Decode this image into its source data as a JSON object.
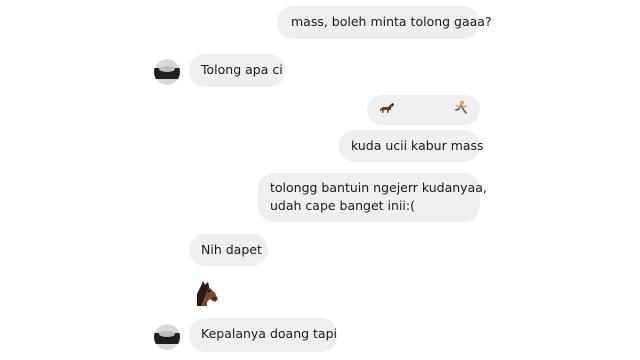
{
  "messages": [
    {
      "id": "m1",
      "side": "sent",
      "text": "mass, boleh minta tolong gaaa?"
    },
    {
      "id": "m2",
      "side": "received",
      "text": "Tolong apa ci",
      "has_avatar": true
    },
    {
      "id": "m3",
      "side": "sent",
      "emoji_icons": [
        "horse-icon",
        "running-person-icon"
      ]
    },
    {
      "id": "m4",
      "side": "sent",
      "text": "kuda ucii kabur mass"
    },
    {
      "id": "m5",
      "side": "sent",
      "lines": [
        "tolongg bantuin ngejerr kudanyaa,",
        "udah cape banget inii:("
      ]
    },
    {
      "id": "m6",
      "side": "received",
      "text": "Nih dapet"
    },
    {
      "id": "m7",
      "side": "received",
      "emoji_icon": "horse-face-icon"
    },
    {
      "id": "m8",
      "side": "received",
      "text": "Kepalanya doang tapi",
      "has_avatar": true
    }
  ],
  "colors": {
    "bubble": "#efefef",
    "text": "#1a1a1a"
  }
}
